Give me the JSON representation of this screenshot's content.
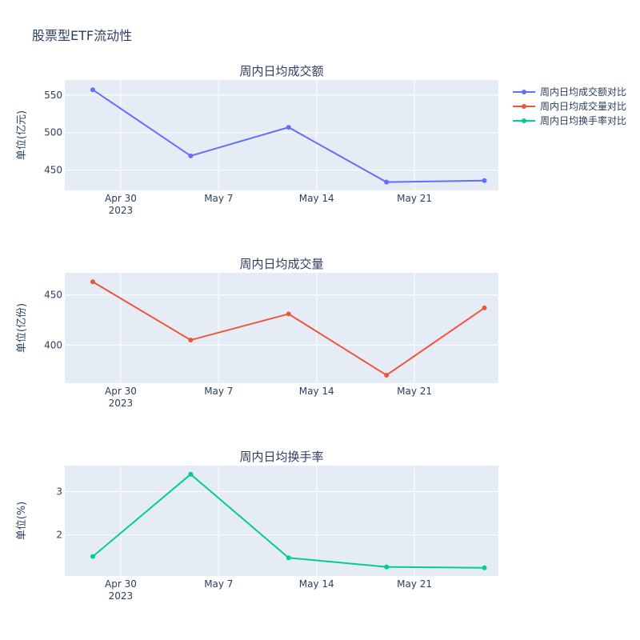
{
  "title": "股票型ETF流动性",
  "chart_data": [
    {
      "type": "line",
      "title": "周内日均成交额",
      "ylabel": "单位(亿元)",
      "xlabel": "",
      "x": [
        "2023-04-28",
        "2023-05-05",
        "2023-05-12",
        "2023-05-19",
        "2023-05-26"
      ],
      "series": [
        {
          "name": "周内日均成交额对比",
          "color": "#636efa",
          "values": [
            557,
            469,
            507,
            434,
            436
          ]
        }
      ],
      "xlim": [
        "2023-04-26",
        "2023-05-27"
      ],
      "xticks": [
        "2023-04-30",
        "2023-05-07",
        "2023-05-14",
        "2023-05-21"
      ],
      "xtick_labels": [
        "Apr 30",
        "May 7",
        "May 14",
        "May 21"
      ],
      "xtick_year": "2023",
      "ylim": [
        423,
        570
      ],
      "yticks": [
        450,
        500,
        550
      ],
      "grid": true,
      "legend": "right"
    },
    {
      "type": "line",
      "title": "周内日均成交量",
      "ylabel": "单位(亿份)",
      "xlabel": "",
      "x": [
        "2023-04-28",
        "2023-05-05",
        "2023-05-12",
        "2023-05-19",
        "2023-05-26"
      ],
      "series": [
        {
          "name": "周内日均成交量对比",
          "color": "#ef553b",
          "values": [
            463,
            405,
            431,
            370,
            437
          ]
        }
      ],
      "xlim": [
        "2023-04-26",
        "2023-05-27"
      ],
      "xticks": [
        "2023-04-30",
        "2023-05-07",
        "2023-05-14",
        "2023-05-21"
      ],
      "xtick_labels": [
        "Apr 30",
        "May 7",
        "May 14",
        "May 21"
      ],
      "xtick_year": "2023",
      "ylim": [
        362,
        472
      ],
      "yticks": [
        400,
        450
      ],
      "grid": true,
      "legend": "right"
    },
    {
      "type": "line",
      "title": "周内日均换手率",
      "ylabel": "单位(%)",
      "xlabel": "",
      "x": [
        "2023-04-28",
        "2023-05-05",
        "2023-05-12",
        "2023-05-19",
        "2023-05-26"
      ],
      "series": [
        {
          "name": "周内日均换手率对比",
          "color": "#00cc96",
          "values": [
            1.5,
            3.4,
            1.47,
            1.26,
            1.24
          ]
        }
      ],
      "xlim": [
        "2023-04-26",
        "2023-05-27"
      ],
      "xticks": [
        "2023-04-30",
        "2023-05-07",
        "2023-05-14",
        "2023-05-21"
      ],
      "xtick_labels": [
        "Apr 30",
        "May 7",
        "May 14",
        "May 21"
      ],
      "xtick_year": "2023",
      "ylim": [
        1.05,
        3.6
      ],
      "yticks": [
        2,
        3
      ],
      "grid": true,
      "legend": "right"
    }
  ]
}
